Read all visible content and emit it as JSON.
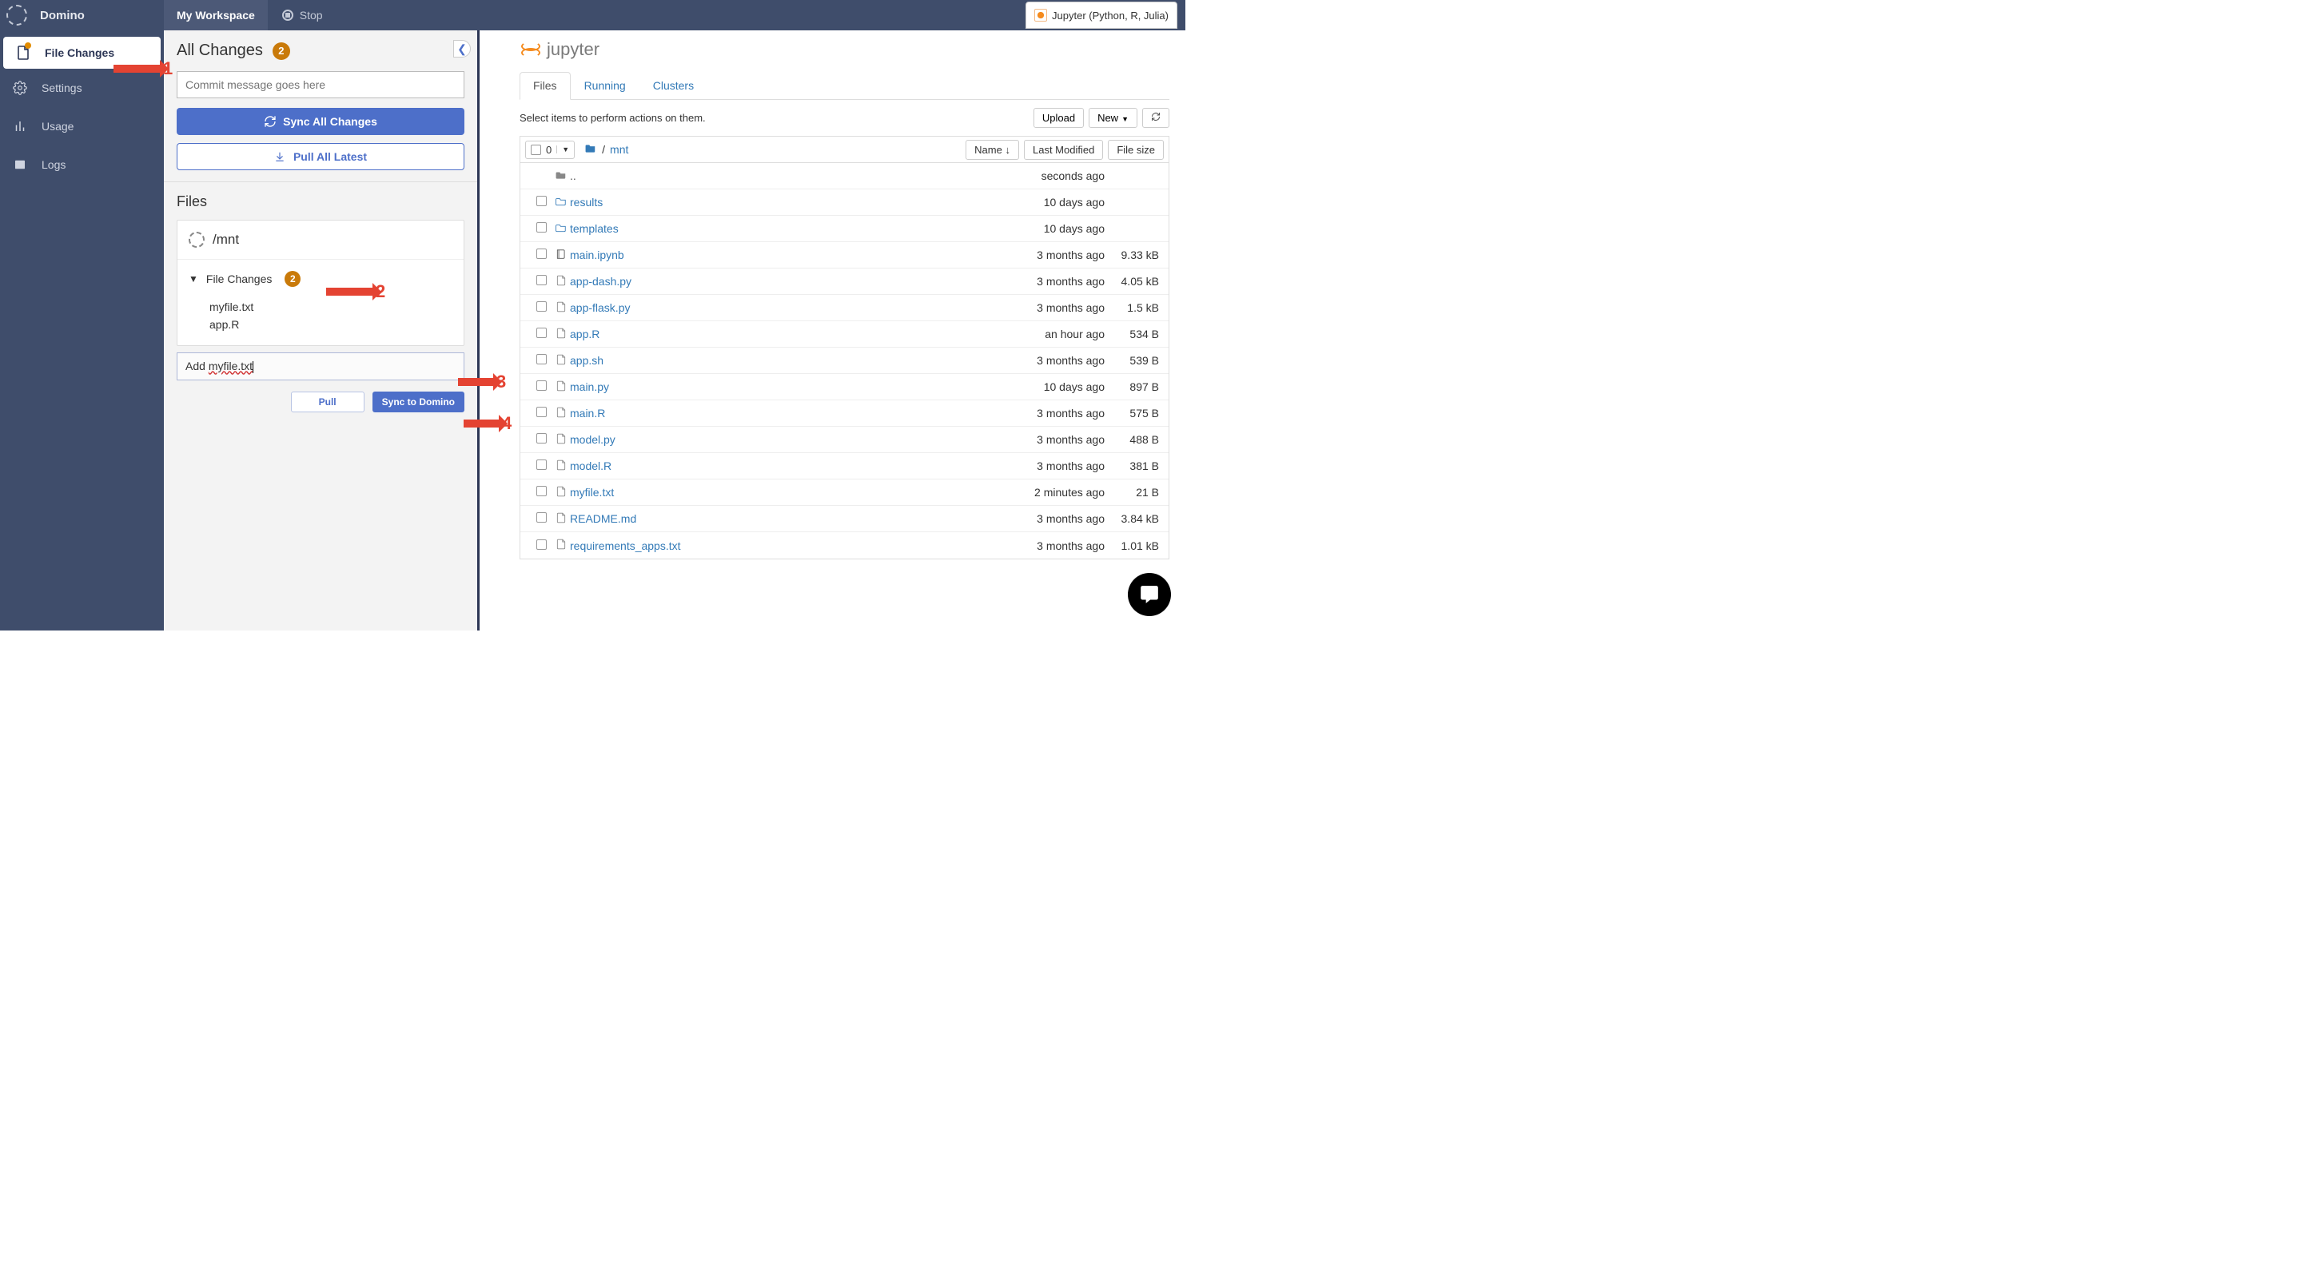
{
  "brand": "Domino",
  "top_tabs": {
    "workspace": "My Workspace",
    "stop": "Stop"
  },
  "kernel_label": "Jupyter (Python, R, Julia)",
  "left_nav": {
    "file_changes": "File Changes",
    "settings": "Settings",
    "usage": "Usage",
    "logs": "Logs"
  },
  "changes_panel": {
    "title": "All Changes",
    "badge": "2",
    "commit_placeholder": "Commit message goes here",
    "sync_all": "Sync All Changes",
    "pull_all": "Pull All Latest",
    "files_header": "Files",
    "mnt_path": "/mnt",
    "file_changes_label": "File Changes",
    "file_changes_badge": "2",
    "changed_files": [
      "myfile.txt",
      "app.R"
    ],
    "partial_prefix": "Add ",
    "partial_underlined": "myfile.txt",
    "pull_btn": "Pull",
    "sync_btn": "Sync to Domino"
  },
  "annotations": {
    "a1": "1",
    "a2": "2",
    "a3": "3",
    "a4": "4"
  },
  "jupyter": {
    "logo": "jupyter",
    "tabs": {
      "files": "Files",
      "running": "Running",
      "clusters": "Clusters"
    },
    "hint": "Select items to perform actions on them.",
    "upload": "Upload",
    "new": "New",
    "selected_count": "0",
    "crumb_sep": "/",
    "crumb_mnt": "mnt",
    "col_name": "Name",
    "col_modified": "Last Modified",
    "col_size": "File size",
    "rows": [
      {
        "kind": "up",
        "name": "..",
        "mod": "seconds ago",
        "size": ""
      },
      {
        "kind": "folder",
        "name": "results",
        "mod": "10 days ago",
        "size": ""
      },
      {
        "kind": "folder",
        "name": "templates",
        "mod": "10 days ago",
        "size": ""
      },
      {
        "kind": "notebook",
        "name": "main.ipynb",
        "mod": "3 months ago",
        "size": "9.33 kB"
      },
      {
        "kind": "file",
        "name": "app-dash.py",
        "mod": "3 months ago",
        "size": "4.05 kB"
      },
      {
        "kind": "file",
        "name": "app-flask.py",
        "mod": "3 months ago",
        "size": "1.5 kB"
      },
      {
        "kind": "file",
        "name": "app.R",
        "mod": "an hour ago",
        "size": "534 B"
      },
      {
        "kind": "file",
        "name": "app.sh",
        "mod": "3 months ago",
        "size": "539 B"
      },
      {
        "kind": "file",
        "name": "main.py",
        "mod": "10 days ago",
        "size": "897 B"
      },
      {
        "kind": "file",
        "name": "main.R",
        "mod": "3 months ago",
        "size": "575 B"
      },
      {
        "kind": "file",
        "name": "model.py",
        "mod": "3 months ago",
        "size": "488 B"
      },
      {
        "kind": "file",
        "name": "model.R",
        "mod": "3 months ago",
        "size": "381 B"
      },
      {
        "kind": "file",
        "name": "myfile.txt",
        "mod": "2 minutes ago",
        "size": "21 B"
      },
      {
        "kind": "file",
        "name": "README.md",
        "mod": "3 months ago",
        "size": "3.84 kB"
      },
      {
        "kind": "file",
        "name": "requirements_apps.txt",
        "mod": "3 months ago",
        "size": "1.01 kB"
      }
    ]
  }
}
